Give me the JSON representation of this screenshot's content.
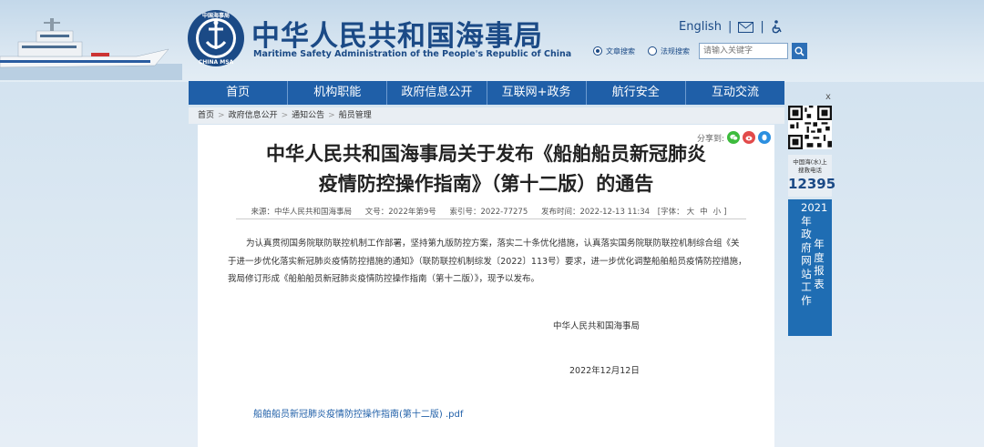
{
  "header": {
    "site_title": "中华人民共和国海事局",
    "site_subtitle": "Maritime Safety Administration of the People's Republic of China",
    "logo_top_text": "中国海事局",
    "logo_bottom_text": "CHINA MSA",
    "english_link": "English",
    "link_separator": "|"
  },
  "search": {
    "option_full": "文章搜索",
    "option_law": "法规搜索",
    "placeholder": "请输入关键字"
  },
  "nav": {
    "items": [
      "首页",
      "机构职能",
      "政府信息公开",
      "互联网+政务",
      "航行安全",
      "互动交流"
    ]
  },
  "breadcrumb": {
    "items": [
      "首页",
      "政府信息公开",
      "通知公告",
      "船员管理"
    ],
    "separator": ">"
  },
  "article": {
    "share_label": "分享到:",
    "title": "中华人民共和国海事局关于发布《船舶船员新冠肺炎疫情防控操作指南》（第十二版）的通告",
    "meta": {
      "source": "来源：中华人民共和国海事局",
      "doc_no": "文号：2022年第9号",
      "index_no": "索引号：2022-77275",
      "publish_time": "发布时间：2022-12-13 11:34",
      "font_label": "[字体：",
      "font_big": "大",
      "font_mid": "中",
      "font_small": "小",
      "font_end": "]"
    },
    "body": "为认真贯彻国务院联防联控机制工作部署，坚持第九版防控方案，落实二十条优化措施，认真落实国务院联防联控机制综合组《关于进一步优化落实新冠肺炎疫情防控措施的通知》（联防联控机制综发〔2022〕113号）要求，进一步优化调整船舶船员疫情防控措施，我局修订形成《船舶船员新冠肺炎疫情防控操作指南（第十二版）》，现予以发布。",
    "signature": "中华人民共和国海事局",
    "date": "2022年12月12日",
    "attachment": "船舶船员新冠肺炎疫情防控操作指南(第十二版) .pdf"
  },
  "sidebar": {
    "close": "x",
    "hotline_line1": "中国海(水)上",
    "hotline_line2": "搜救电话",
    "hotline_number": "12395",
    "report_col1": "2021年政府网站工作",
    "report_col2": "年度报表"
  },
  "colors": {
    "brand_blue": "#1b4a86",
    "nav_blue": "#1f5fa8"
  }
}
